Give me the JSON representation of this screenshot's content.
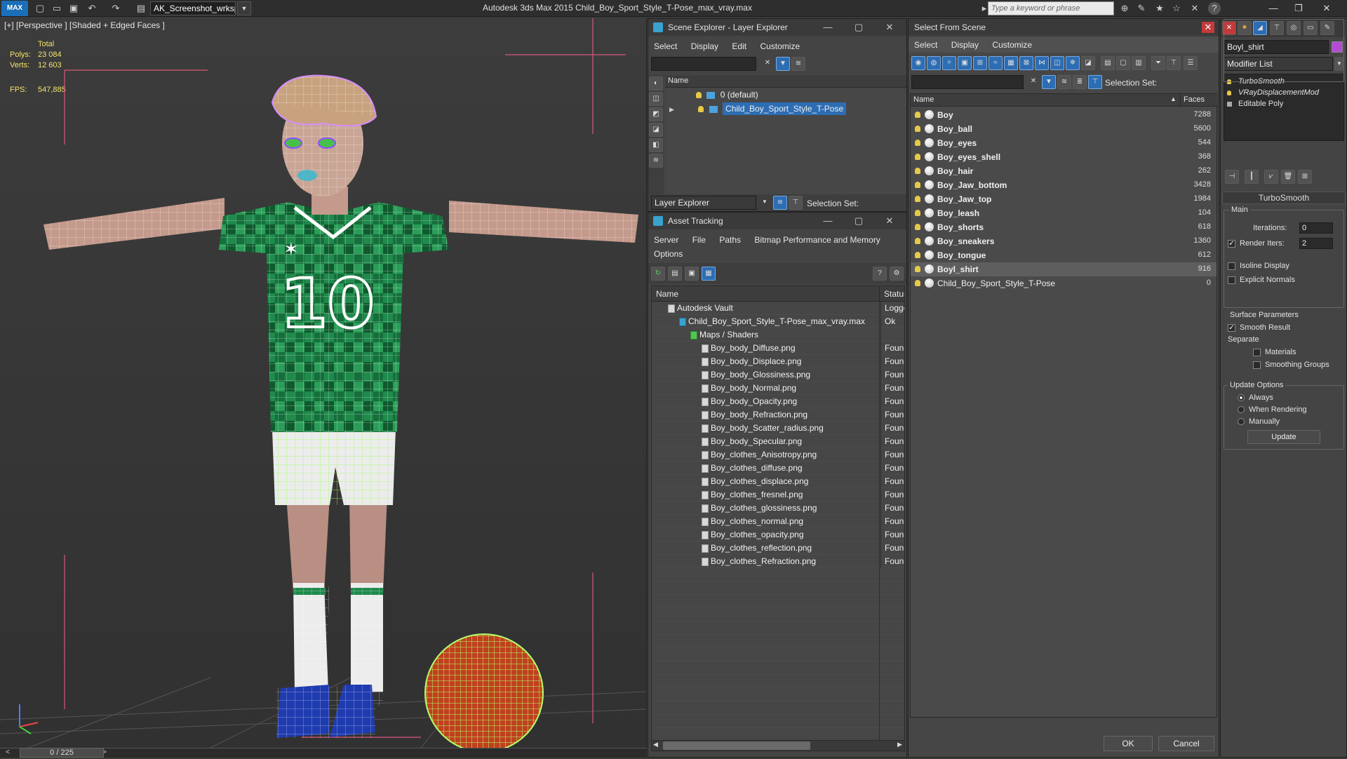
{
  "titlebar": {
    "logo": "MAX",
    "workspace": "AK_Screenshot_wrksp",
    "title": "Autodesk 3ds Max  2015    Child_Boy_Sport_Style_T-Pose_max_vray.max",
    "search_placeholder": "Type a keyword or phrase",
    "window_controls": [
      "—",
      "❐",
      "✕"
    ]
  },
  "viewport": {
    "label": "[+] [Perspective ] [Shaded + Edged Faces ]",
    "stats": {
      "header": "Total",
      "polys_label": "Polys:",
      "polys": "23 084",
      "verts_label": "Verts:",
      "verts": "12 603",
      "fps_label": "FPS:",
      "fps": "547,885"
    },
    "time_slider": "0 / 225"
  },
  "scene_explorer": {
    "title": "Scene Explorer - Layer Explorer",
    "menu": [
      "Select",
      "Display",
      "Edit",
      "Customize"
    ],
    "column_name": "Name",
    "layers": [
      {
        "name": "0 (default)",
        "selected": false
      },
      {
        "name": "Child_Boy_Sport_Style_T-Pose",
        "selected": true
      }
    ],
    "footer_dropdown": "Layer Explorer",
    "selection_set_label": "Selection Set:"
  },
  "asset_tracking": {
    "title": "Asset Tracking",
    "menu": [
      "Server",
      "File",
      "Paths",
      "Bitmap Performance and Memory"
    ],
    "menu2": [
      "Options"
    ],
    "col_name": "Name",
    "col_status": "Status",
    "rows": [
      {
        "name": "Autodesk Vault",
        "status": "Logged",
        "indent": 1
      },
      {
        "name": "Child_Boy_Sport_Style_T-Pose_max_vray.max",
        "status": "Ok",
        "indent": 2
      },
      {
        "name": "Maps / Shaders",
        "status": "",
        "indent": 3
      },
      {
        "name": "Boy_body_Diffuse.png",
        "status": "Found",
        "indent": 4
      },
      {
        "name": "Boy_body_Displace.png",
        "status": "Found",
        "indent": 4
      },
      {
        "name": "Boy_body_Glossiness.png",
        "status": "Found",
        "indent": 4
      },
      {
        "name": "Boy_body_Normal.png",
        "status": "Found",
        "indent": 4
      },
      {
        "name": "Boy_body_Opacity.png",
        "status": "Found",
        "indent": 4
      },
      {
        "name": "Boy_body_Refraction.png",
        "status": "Found",
        "indent": 4
      },
      {
        "name": "Boy_body_Scatter_radius.png",
        "status": "Found",
        "indent": 4
      },
      {
        "name": "Boy_body_Specular.png",
        "status": "Found",
        "indent": 4
      },
      {
        "name": "Boy_clothes_Anisotropy.png",
        "status": "Found",
        "indent": 4
      },
      {
        "name": "Boy_clothes_diffuse.png",
        "status": "Found",
        "indent": 4
      },
      {
        "name": "Boy_clothes_displace.png",
        "status": "Found",
        "indent": 4
      },
      {
        "name": "Boy_clothes_fresnel.png",
        "status": "Found",
        "indent": 4
      },
      {
        "name": "Boy_clothes_glossiness.png",
        "status": "Found",
        "indent": 4
      },
      {
        "name": "Boy_clothes_normal.png",
        "status": "Found",
        "indent": 4
      },
      {
        "name": "Boy_clothes_opacity.png",
        "status": "Found",
        "indent": 4
      },
      {
        "name": "Boy_clothes_reflection.png",
        "status": "Found",
        "indent": 4
      },
      {
        "name": "Boy_clothes_Refraction.png",
        "status": "Found",
        "indent": 4
      }
    ]
  },
  "select_from_scene": {
    "title": "Select From Scene",
    "menu": [
      "Select",
      "Display",
      "Customize"
    ],
    "selection_set_label": "Selection Set:",
    "col_name": "Name",
    "col_faces": "Faces",
    "rows": [
      {
        "name": "Boy",
        "faces": "7288",
        "selected": false
      },
      {
        "name": "Boy_ball",
        "faces": "5600",
        "selected": false
      },
      {
        "name": "Boy_eyes",
        "faces": "544",
        "selected": false
      },
      {
        "name": "Boy_eyes_shell",
        "faces": "368",
        "selected": false
      },
      {
        "name": "Boy_hair",
        "faces": "262",
        "selected": false
      },
      {
        "name": "Boy_Jaw_bottom",
        "faces": "3428",
        "selected": false
      },
      {
        "name": "Boy_Jaw_top",
        "faces": "1984",
        "selected": false
      },
      {
        "name": "Boy_leash",
        "faces": "104",
        "selected": false
      },
      {
        "name": "Boy_shorts",
        "faces": "618",
        "selected": false
      },
      {
        "name": "Boy_sneakers",
        "faces": "1360",
        "selected": false
      },
      {
        "name": "Boy_tongue",
        "faces": "612",
        "selected": false
      },
      {
        "name": "Boyl_shirt",
        "faces": "916",
        "selected": true
      },
      {
        "name": "Child_Boy_Sport_Style_T-Pose",
        "faces": "0",
        "selected": false
      }
    ],
    "ok": "OK",
    "cancel": "Cancel"
  },
  "command_panel": {
    "object_name": "Boyl_shirt",
    "modifier_list": "Modifier List",
    "stack": [
      "TurboSmooth",
      "VRayDisplacementMod",
      "Editable Poly"
    ],
    "rollout_title": "TurboSmooth",
    "main_label": "Main",
    "iterations_label": "Iterations:",
    "iterations": "0",
    "render_iters_label": "Render Iters:",
    "render_iters": "2",
    "isoline": "Isoline Display",
    "explicit_normals": "Explicit Normals",
    "surface_params": "Surface Parameters",
    "smooth_result": "Smooth Result",
    "separate": "Separate",
    "materials": "Materials",
    "smoothing_groups": "Smoothing Groups",
    "update_options": "Update Options",
    "always": "Always",
    "when_rendering": "When Rendering",
    "manually": "Manually",
    "update_button": "Update"
  },
  "colors": {
    "accent": "#2d6db3",
    "jersey": "#1f8a4c",
    "stats": "#f5e36a"
  }
}
